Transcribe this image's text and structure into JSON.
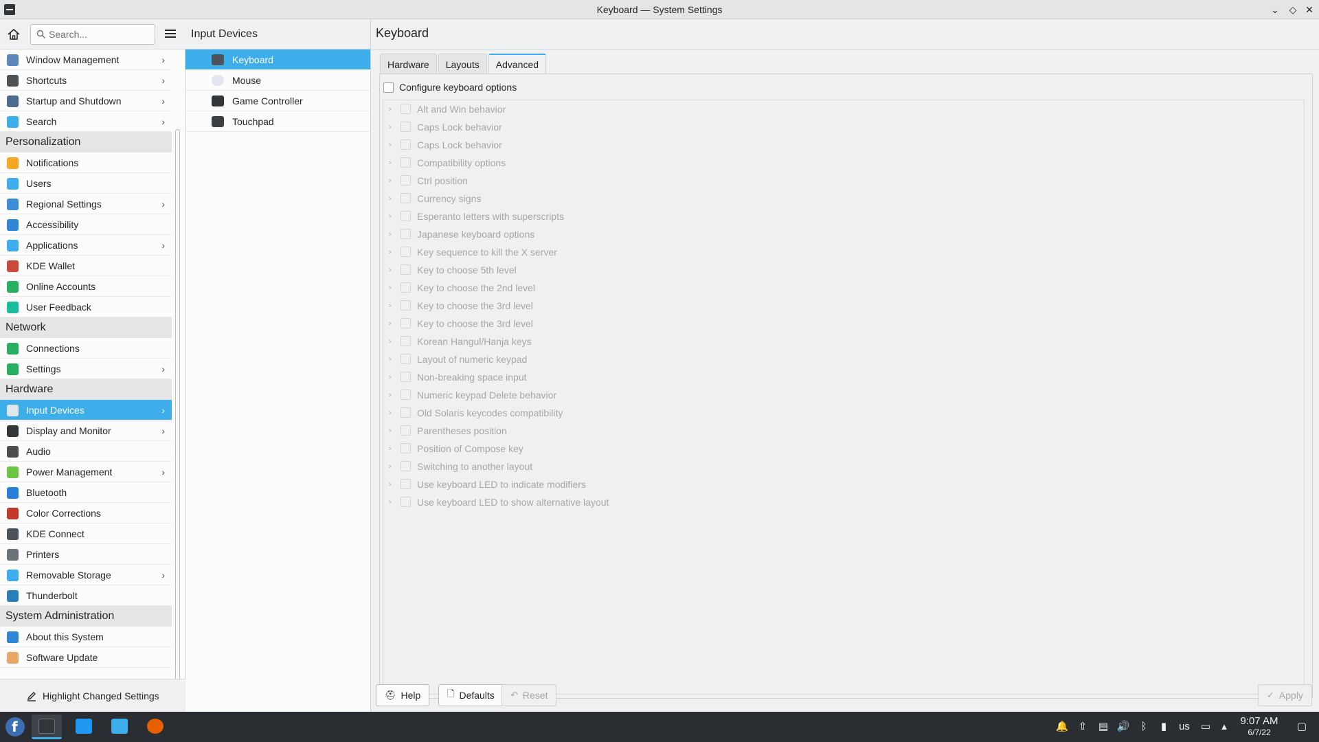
{
  "window": {
    "title": "Keyboard — System Settings"
  },
  "sidebar": {
    "search_placeholder": "Search...",
    "items": [
      {
        "kind": "item",
        "label": "Window Management",
        "icon": "window-management-icon",
        "arrow": true,
        "color": "#5b88b8"
      },
      {
        "kind": "item",
        "label": "Shortcuts",
        "icon": "keyboard-shortcuts-icon",
        "arrow": true,
        "color": "#4d5459"
      },
      {
        "kind": "item",
        "label": "Startup and Shutdown",
        "icon": "startup-icon",
        "arrow": true,
        "color": "#4d6a8f"
      },
      {
        "kind": "item",
        "label": "Search",
        "icon": "search-icon",
        "arrow": true,
        "color": "#3daee9"
      },
      {
        "kind": "header",
        "label": "Personalization"
      },
      {
        "kind": "item",
        "label": "Notifications",
        "icon": "bell-icon",
        "arrow": false,
        "color": "#f5a623"
      },
      {
        "kind": "item",
        "label": "Users",
        "icon": "users-icon",
        "arrow": false,
        "color": "#3daee9"
      },
      {
        "kind": "item",
        "label": "Regional Settings",
        "icon": "regional-icon",
        "arrow": true,
        "color": "#3b8ed6"
      },
      {
        "kind": "item",
        "label": "Accessibility",
        "icon": "accessibility-icon",
        "arrow": false,
        "color": "#2f86d4"
      },
      {
        "kind": "item",
        "label": "Applications",
        "icon": "applications-icon",
        "arrow": true,
        "color": "#3daee9"
      },
      {
        "kind": "item",
        "label": "KDE Wallet",
        "icon": "wallet-icon",
        "arrow": false,
        "color": "#c94a3a"
      },
      {
        "kind": "item",
        "label": "Online Accounts",
        "icon": "online-accounts-icon",
        "arrow": false,
        "color": "#27ae60"
      },
      {
        "kind": "item",
        "label": "User Feedback",
        "icon": "feedback-icon",
        "arrow": false,
        "color": "#1abc9c"
      },
      {
        "kind": "header",
        "label": "Network"
      },
      {
        "kind": "item",
        "label": "Connections",
        "icon": "globe-icon",
        "arrow": false,
        "color": "#27ae60"
      },
      {
        "kind": "item",
        "label": "Settings",
        "icon": "network-settings-icon",
        "arrow": true,
        "color": "#27ae60"
      },
      {
        "kind": "header",
        "label": "Hardware"
      },
      {
        "kind": "item",
        "label": "Input Devices",
        "icon": "mouse-icon",
        "arrow": true,
        "selected": true,
        "color": "#dfe6ee"
      },
      {
        "kind": "item",
        "label": "Display and Monitor",
        "icon": "monitor-icon",
        "arrow": true,
        "color": "#31363b"
      },
      {
        "kind": "item",
        "label": "Audio",
        "icon": "speaker-icon",
        "arrow": false,
        "color": "#4d4d4d"
      },
      {
        "kind": "item",
        "label": "Power Management",
        "icon": "power-icon",
        "arrow": true,
        "color": "#6cc644"
      },
      {
        "kind": "item",
        "label": "Bluetooth",
        "icon": "bluetooth-icon",
        "arrow": false,
        "color": "#2980d9"
      },
      {
        "kind": "item",
        "label": "Color Corrections",
        "icon": "color-icon",
        "arrow": false,
        "color": "#c0392b"
      },
      {
        "kind": "item",
        "label": "KDE Connect",
        "icon": "phone-icon",
        "arrow": false,
        "color": "#4d5459"
      },
      {
        "kind": "item",
        "label": "Printers",
        "icon": "printer-icon",
        "arrow": false,
        "color": "#6c7479"
      },
      {
        "kind": "item",
        "label": "Removable Storage",
        "icon": "usb-icon",
        "arrow": true,
        "color": "#3daee9"
      },
      {
        "kind": "item",
        "label": "Thunderbolt",
        "icon": "thunderbolt-icon",
        "arrow": false,
        "color": "#2980b9"
      },
      {
        "kind": "header",
        "label": "System Administration"
      },
      {
        "kind": "item",
        "label": "About this System",
        "icon": "info-icon",
        "arrow": false,
        "color": "#2f86d4"
      },
      {
        "kind": "item",
        "label": "Software Update",
        "icon": "update-icon",
        "arrow": false,
        "color": "#e8a86a"
      }
    ],
    "highlight_label": "Highlight Changed Settings"
  },
  "subpanel": {
    "title": "Input Devices",
    "items": [
      {
        "label": "Keyboard",
        "icon": "keyboard-icon",
        "selected": true
      },
      {
        "label": "Mouse",
        "icon": "mouse-icon"
      },
      {
        "label": "Game Controller",
        "icon": "gamepad-icon"
      },
      {
        "label": "Touchpad",
        "icon": "touchpad-icon"
      }
    ]
  },
  "main": {
    "title": "Keyboard",
    "tabs": [
      {
        "label": "Hardware"
      },
      {
        "label": "Layouts"
      },
      {
        "label": "Advanced",
        "active": true
      }
    ],
    "configure_label": "Configure keyboard options",
    "options": [
      "Alt and Win behavior",
      "Caps Lock behavior",
      "Caps Lock behavior",
      "Compatibility options",
      "Ctrl position",
      "Currency signs",
      "Esperanto letters with superscripts",
      "Japanese keyboard options",
      "Key sequence to kill the X server",
      "Key to choose 5th level",
      "Key to choose the 2nd level",
      "Key to choose the 3rd level",
      "Key to choose the 3rd level",
      "Korean Hangul/Hanja keys",
      "Layout of numeric keypad",
      "Non-breaking space input",
      "Numeric keypad Delete behavior",
      "Old Solaris keycodes compatibility",
      "Parentheses position",
      "Position of Compose key",
      "Switching to another layout",
      "Use keyboard LED to indicate modifiers",
      "Use keyboard LED to show alternative layout"
    ],
    "buttons": {
      "help": "Help",
      "defaults": "Defaults",
      "reset": "Reset",
      "apply": "Apply"
    }
  },
  "taskbar": {
    "layout_indicator": "us",
    "time": "9:07 AM",
    "date": "6/7/22"
  }
}
